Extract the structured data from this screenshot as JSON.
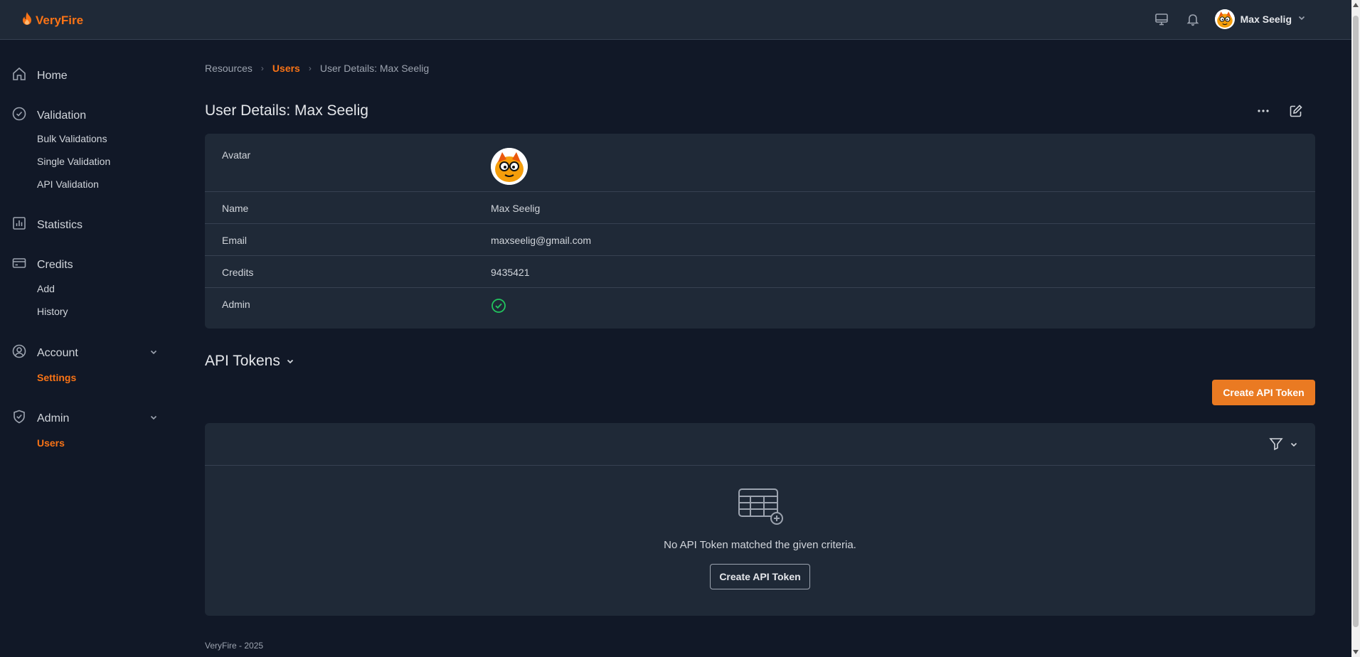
{
  "app": {
    "name": "VeryFire"
  },
  "header": {
    "user_name": "Max Seelig"
  },
  "sidebar": {
    "home": "Home",
    "validation": {
      "label": "Validation",
      "items": [
        "Bulk Validations",
        "Single Validation",
        "API Validation"
      ]
    },
    "statistics": "Statistics",
    "credits": {
      "label": "Credits",
      "items": [
        "Add",
        "History"
      ]
    },
    "account": {
      "label": "Account",
      "items": [
        "Settings"
      ]
    },
    "admin": {
      "label": "Admin",
      "items": [
        "Users"
      ]
    }
  },
  "breadcrumb": [
    "Resources",
    "Users",
    "User Details: Max Seelig"
  ],
  "page": {
    "title": "User Details: Max Seelig"
  },
  "details": {
    "avatar_label": "Avatar",
    "name_label": "Name",
    "name": "Max Seelig",
    "email_label": "Email",
    "email": "maxseelig@gmail.com",
    "credits_label": "Credits",
    "credits": "9435421",
    "admin_label": "Admin",
    "admin": true
  },
  "api_tokens": {
    "title": "API Tokens",
    "create_label": "Create API Token",
    "empty_text": "No API Token matched the given criteria.",
    "empty_create_label": "Create API Token"
  },
  "footer": {
    "text": "VeryFire - 2025"
  },
  "colors": {
    "accent": "#f97316",
    "background": "#111827",
    "card": "#1f2937",
    "success": "#22c55e"
  }
}
